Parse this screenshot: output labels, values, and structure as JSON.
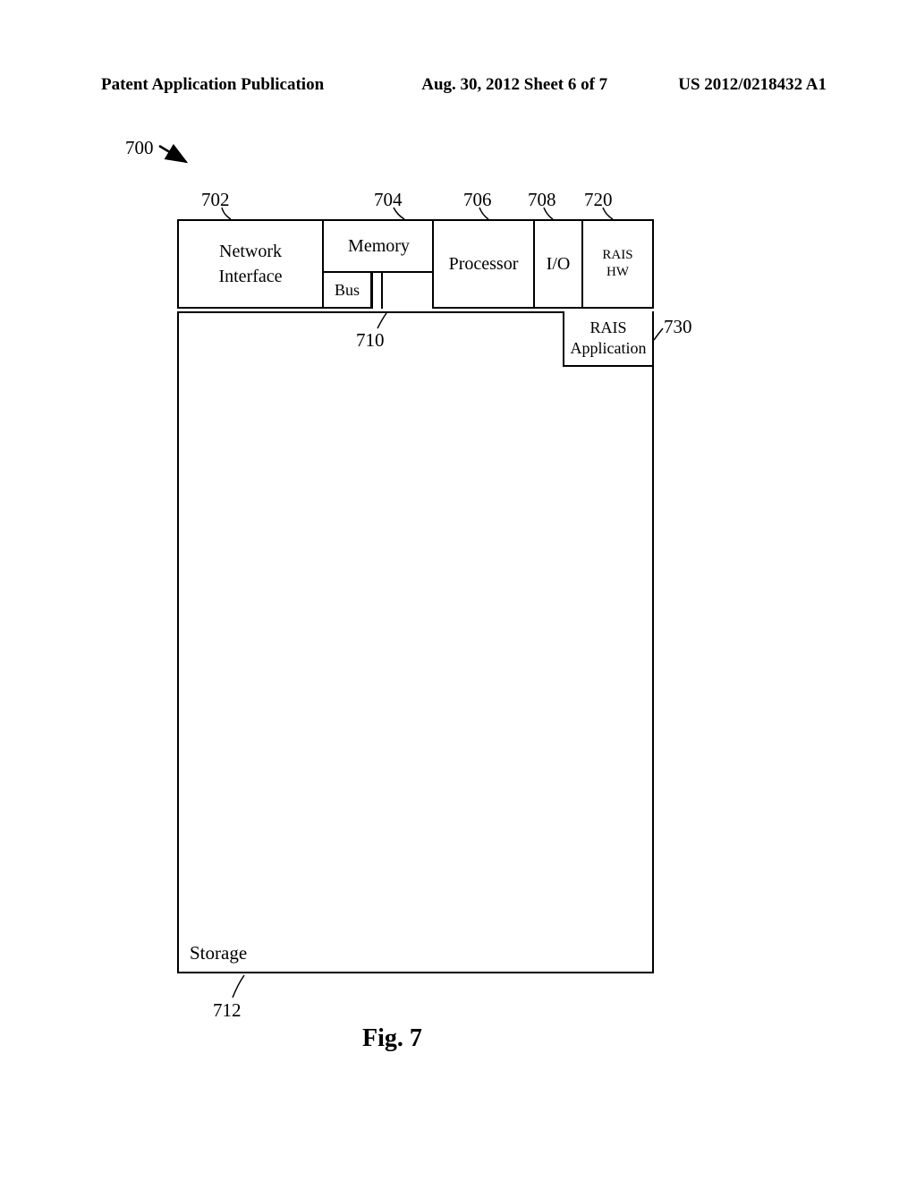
{
  "header": {
    "left": "Patent Application Publication",
    "center": "Aug. 30, 2012  Sheet 6 of 7",
    "right": "US 2012/0218432 A1"
  },
  "refs": {
    "r700": "700",
    "r702": "702",
    "r704": "704",
    "r706": "706",
    "r708": "708",
    "r720": "720",
    "r730": "730",
    "r710": "710",
    "r712": "712"
  },
  "blocks": {
    "network_interface": "Network\nInterface",
    "memory": "Memory",
    "bus": "Bus",
    "processor": "Processor",
    "io": "I/O",
    "rais_hw": "RAIS\nHW",
    "rais_app": "RAIS\nApplication",
    "storage": "Storage"
  },
  "figure_label": "Fig. 7"
}
